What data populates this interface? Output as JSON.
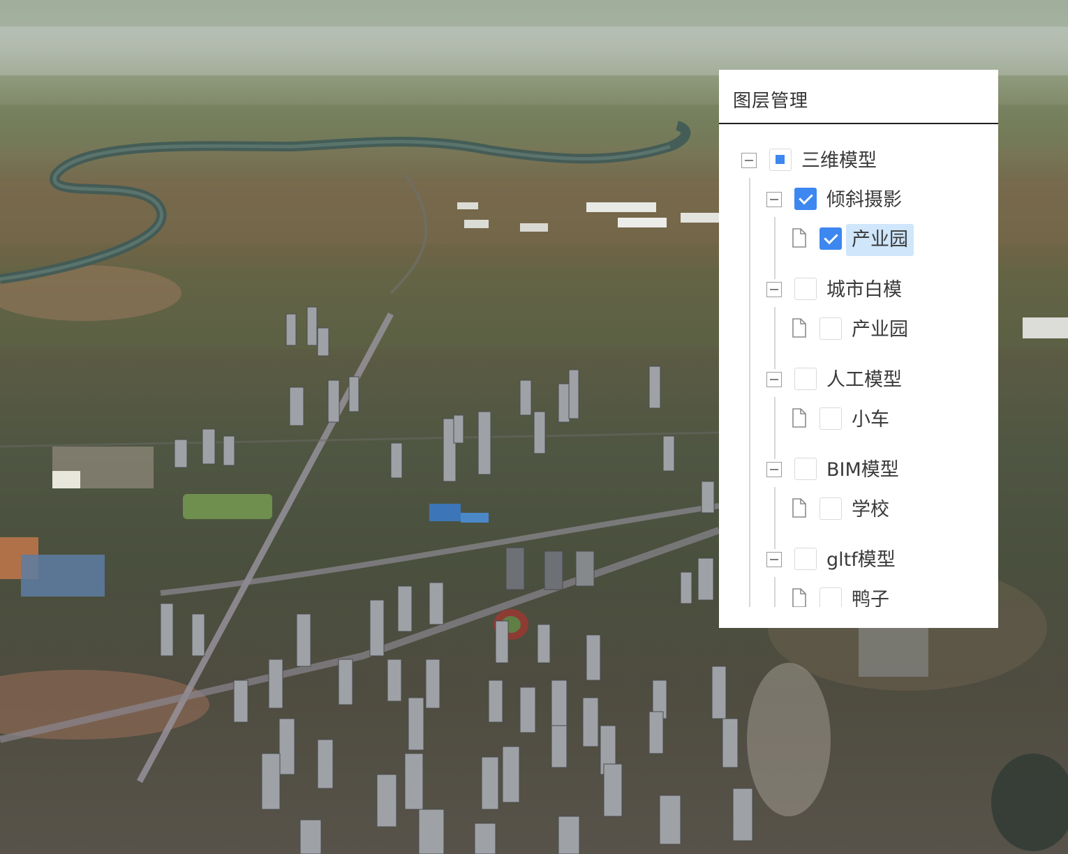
{
  "panel": {
    "title": "图层管理"
  },
  "tree": [
    {
      "label": "三维模型",
      "state": "partial",
      "children": [
        {
          "label": "倾斜摄影",
          "state": "checked",
          "children": [
            {
              "label": "产业园",
              "state": "checked",
              "selected": true
            }
          ]
        },
        {
          "label": "城市白模",
          "state": "unchecked",
          "children": [
            {
              "label": "产业园",
              "state": "unchecked"
            }
          ]
        },
        {
          "label": "人工模型",
          "state": "unchecked",
          "children": [
            {
              "label": "小车",
              "state": "unchecked"
            }
          ]
        },
        {
          "label": "BIM模型",
          "state": "unchecked",
          "children": [
            {
              "label": "学校",
              "state": "unchecked"
            }
          ]
        },
        {
          "label": "gltf模型",
          "state": "unchecked",
          "children": [
            {
              "label": "鸭子",
              "state": "unchecked"
            }
          ]
        }
      ]
    }
  ],
  "colors": {
    "checkbox_checked": "#3d87f0",
    "selected_label_bg": "#cfe6fb"
  },
  "icons": {
    "expander": "minus-square-icon",
    "leaf": "file-icon"
  }
}
